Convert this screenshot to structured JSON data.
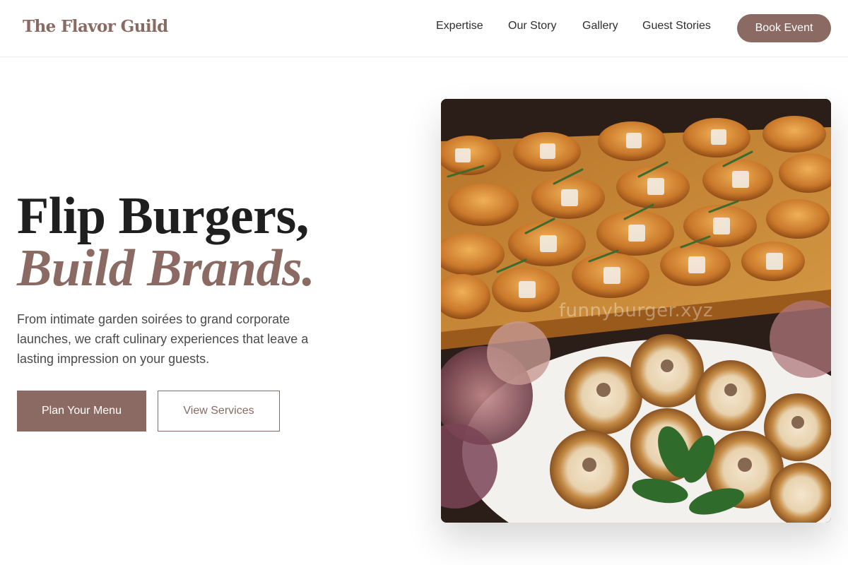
{
  "header": {
    "brand": "The Flavor Guild",
    "nav": [
      "Expertise",
      "Our Story",
      "Gallery",
      "Guest Stories"
    ],
    "cta": "Book Event"
  },
  "hero": {
    "title_line1": "Flip Burgers,",
    "title_line2": "Build Brands.",
    "description": "From intimate garden soirées to grand corporate launches, we craft culinary experiences that leave a lasting impression on your guests.",
    "primary_button": "Plan Your Menu",
    "secondary_button": "View Services"
  },
  "image": {
    "watermark": "funnyburger.xyz"
  },
  "colors": {
    "accent": "#8a6a62",
    "text": "#1f1f1f",
    "border": "#ececec"
  }
}
